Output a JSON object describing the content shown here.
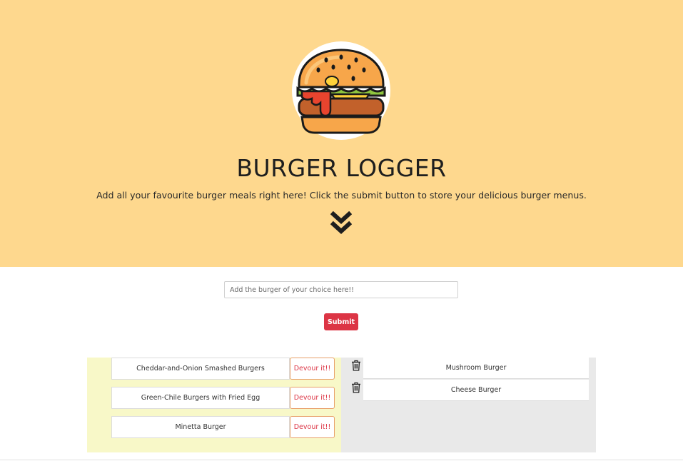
{
  "header": {
    "title": "BURGER LOGGER",
    "subtitle": "Add all your favourite burger meals right here! Click the submit button to store your delicious burger menus.",
    "logo_icon": "burger-icon",
    "scroll_icon": "double-chevron-down-icon",
    "background_color": "#fed88e"
  },
  "form": {
    "placeholder": "Add the burger of your choice here!!",
    "value": "",
    "submit_label": "Submit",
    "submit_color": "#dc3545"
  },
  "uneaten": {
    "background_color": "#f8f8c8",
    "devour_label": "Devour it!!",
    "items": [
      {
        "name": "Cheddar-and-Onion Smashed Burgers"
      },
      {
        "name": "Green-Chile Burgers with Fried Egg"
      },
      {
        "name": "Minetta Burger"
      }
    ]
  },
  "devoured": {
    "background_color": "#e9e9e9",
    "delete_icon": "trash-icon",
    "items": [
      {
        "name": "Mushroom Burger"
      },
      {
        "name": "Cheese Burger"
      }
    ]
  }
}
